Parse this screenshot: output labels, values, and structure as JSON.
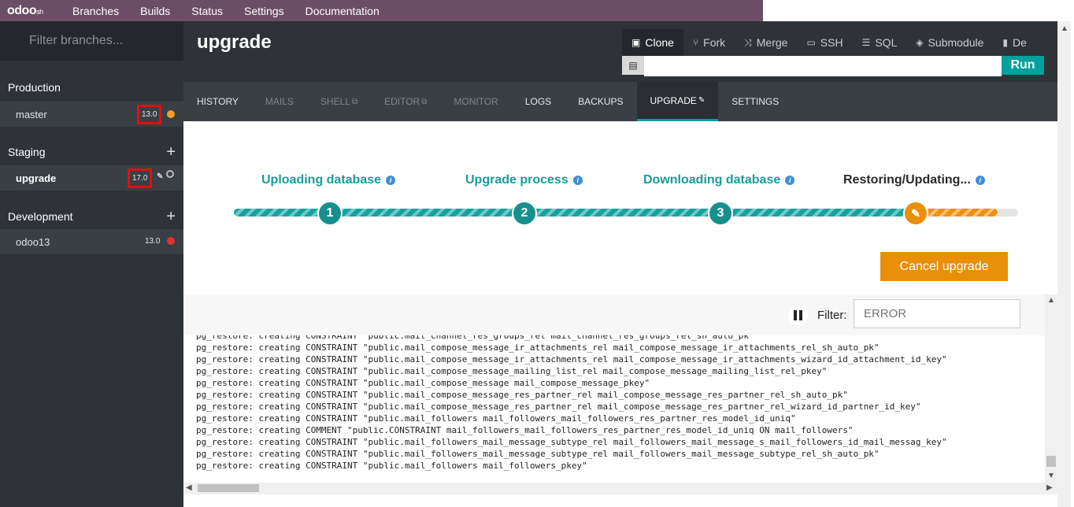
{
  "topbar": {
    "logo_main": "odoo",
    "logo_sub": "sh",
    "nav": [
      "Branches",
      "Builds",
      "Status",
      "Settings",
      "Documentation"
    ]
  },
  "sidebar": {
    "filter_placeholder": "Filter branches...",
    "sections": [
      {
        "label": "Production",
        "branches": [
          {
            "name": "master",
            "version": "13.0"
          }
        ]
      },
      {
        "label": "Staging",
        "branches": [
          {
            "name": "upgrade",
            "version": "17.0"
          }
        ]
      },
      {
        "label": "Development",
        "branches": [
          {
            "name": "odoo13",
            "version": "13.0"
          }
        ]
      }
    ],
    "plus": "+"
  },
  "header": {
    "title": "upgrade",
    "actions": [
      "Clone",
      "Fork",
      "Merge",
      "SSH",
      "SQL",
      "Submodule",
      "De"
    ],
    "run_label": "Run",
    "command_value": ""
  },
  "tabs": [
    "HISTORY",
    "MAILS",
    "SHELL",
    "EDITOR",
    "MONITOR",
    "LOGS",
    "BACKUPS",
    "UPGRADE",
    "SETTINGS"
  ],
  "steps": [
    "Uploading database",
    "Upgrade process",
    "Downloading database",
    "Restoring/Updating..."
  ],
  "step_numbers": [
    "1",
    "2",
    "3"
  ],
  "progress": {
    "current_step": 4,
    "step_fraction": 0.8
  },
  "cancel_label": "Cancel upgrade",
  "filter": {
    "label": "Filter:",
    "value": "ERROR"
  },
  "log_lines": [
    "pg_restore: creating CONSTRAINT \"public.mail_channel_res_groups_rel mail_channel_res_groups_rel_sh_auto_pk\"",
    "pg_restore: creating CONSTRAINT \"public.mail_compose_message_ir_attachments_rel mail_compose_message_ir_attachments_rel_sh_auto_pk\"",
    "pg_restore: creating CONSTRAINT \"public.mail_compose_message_ir_attachments_rel mail_compose_message_ir_attachments_wizard_id_attachment_id_key\"",
    "pg_restore: creating CONSTRAINT \"public.mail_compose_message_mailing_list_rel mail_compose_message_mailing_list_rel_pkey\"",
    "pg_restore: creating CONSTRAINT \"public.mail_compose_message mail_compose_message_pkey\"",
    "pg_restore: creating CONSTRAINT \"public.mail_compose_message_res_partner_rel mail_compose_message_res_partner_rel_sh_auto_pk\"",
    "pg_restore: creating CONSTRAINT \"public.mail_compose_message_res_partner_rel mail_compose_message_res_partner_rel_wizard_id_partner_id_key\"",
    "pg_restore: creating CONSTRAINT \"public.mail_followers mail_followers_mail_followers_res_partner_res_model_id_uniq\"",
    "pg_restore: creating COMMENT \"public.CONSTRAINT mail_followers_mail_followers_res_partner_res_model_id_uniq ON mail_followers\"",
    "pg_restore: creating CONSTRAINT \"public.mail_followers_mail_message_subtype_rel mail_followers_mail_message_s_mail_followers_id_mail_messag_key\"",
    "pg_restore: creating CONSTRAINT \"public.mail_followers_mail_message_subtype_rel mail_followers_mail_message_subtype_rel_sh_auto_pk\"",
    "pg_restore: creating CONSTRAINT \"public.mail_followers mail_followers_pkey\""
  ],
  "colors": {
    "teal": "#00a09d",
    "orange": "#e8900a",
    "topbar": "#6b4e66",
    "dark": "#2f3338"
  }
}
